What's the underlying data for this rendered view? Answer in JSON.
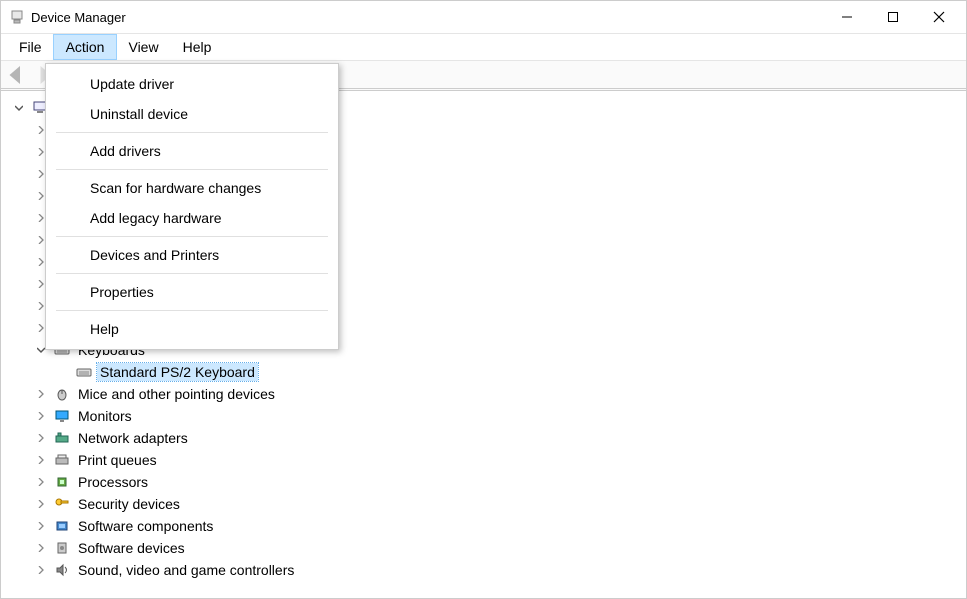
{
  "title": "Device Manager",
  "menu": {
    "file": "File",
    "action": "Action",
    "view": "View",
    "help": "Help"
  },
  "action_menu": {
    "update_driver": "Update driver",
    "uninstall_device": "Uninstall device",
    "add_drivers": "Add drivers",
    "scan_hardware": "Scan for hardware changes",
    "add_legacy": "Add legacy hardware",
    "devices_printers": "Devices and Printers",
    "properties": "Properties",
    "help": "Help"
  },
  "tree": {
    "keyboards": "Keyboards",
    "keyboard_child": "Standard PS/2 Keyboard",
    "mice": "Mice and other pointing devices",
    "monitors": "Monitors",
    "network": "Network adapters",
    "print_queues": "Print queues",
    "processors": "Processors",
    "security": "Security devices",
    "soft_components": "Software components",
    "soft_devices": "Software devices",
    "sound": "Sound, video and game controllers"
  }
}
